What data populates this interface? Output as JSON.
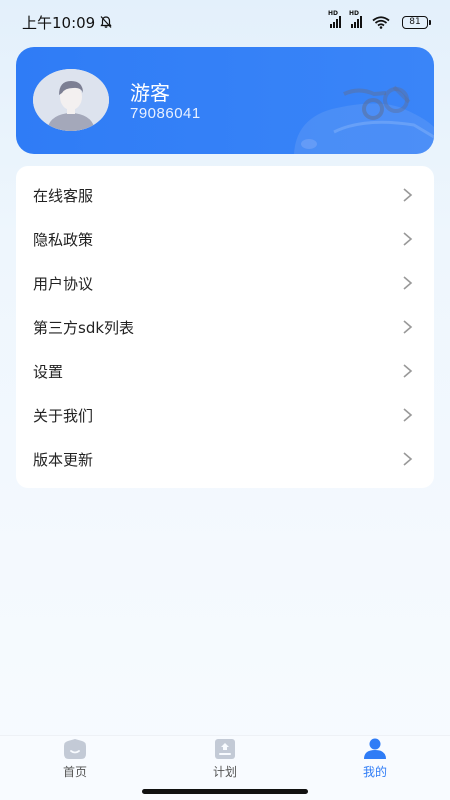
{
  "status_bar": {
    "time": "上午10:09",
    "battery": "81",
    "signal_label_1": "HD",
    "signal_label_2": "HD"
  },
  "profile": {
    "name": "游客",
    "id": "79086041"
  },
  "menu": {
    "items": [
      {
        "label": "在线客服"
      },
      {
        "label": "隐私政策"
      },
      {
        "label": "用户协议"
      },
      {
        "label": "第三方sdk列表"
      },
      {
        "label": "设置"
      },
      {
        "label": "关于我们"
      },
      {
        "label": "版本更新"
      }
    ]
  },
  "bottom_nav": {
    "items": [
      {
        "label": "首页",
        "icon": "home-icon",
        "active": false
      },
      {
        "label": "计划",
        "icon": "plan-icon",
        "active": false
      },
      {
        "label": "我的",
        "icon": "profile-icon",
        "active": true
      }
    ]
  },
  "colors": {
    "accent": "#2f7cf6",
    "background": "#eef6fd"
  }
}
